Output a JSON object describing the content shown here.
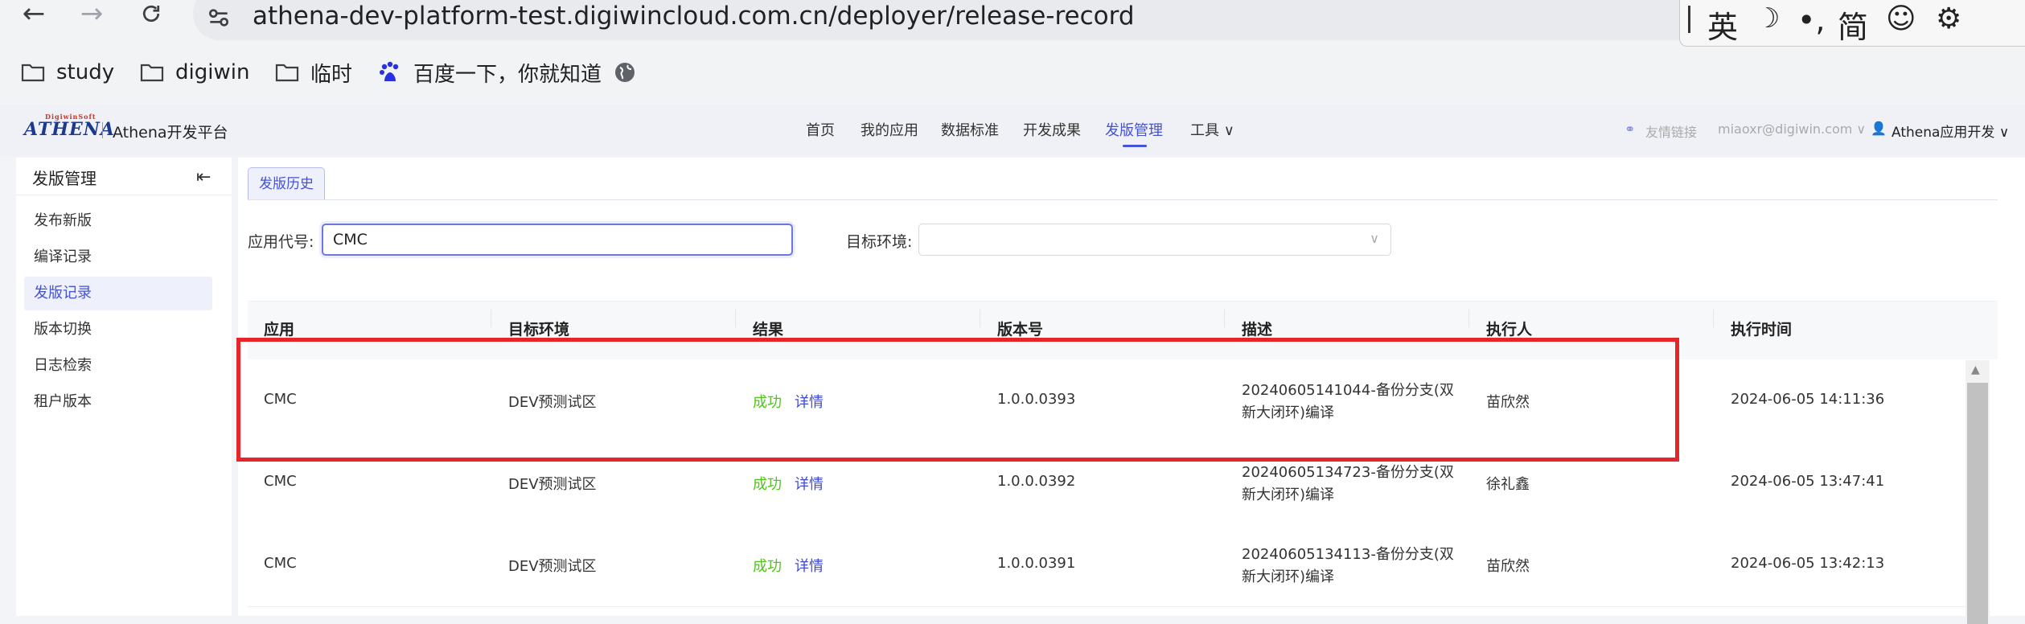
{
  "browser": {
    "url": "athena-dev-platform-test.digiwincloud.com.cn/deployer/release-record",
    "bookmarks": [
      "study",
      "digiwin",
      "临时",
      "百度一下，你就知道"
    ],
    "ime": [
      "英",
      "简"
    ]
  },
  "header": {
    "logo_text": "ATHENA",
    "logo_small": "DigiwinSoft",
    "platform": "Athena开发平台",
    "nav": [
      "首页",
      "我的应用",
      "数据标准",
      "开发成果",
      "发版管理",
      "工具 ∨"
    ],
    "active_nav": "发版管理",
    "links": [
      "友情链接",
      "miaoxr@digiwin.com ∨"
    ],
    "user": "Athena应用开发 ∨"
  },
  "sidebar": {
    "title": "发版管理",
    "items": [
      "发布新版",
      "编译记录",
      "发版记录",
      "版本切换",
      "日志检索",
      "租户版本"
    ],
    "active_item": "发版记录"
  },
  "main": {
    "tab": "发版历史",
    "filters": {
      "app_code_label": "应用代号:",
      "app_code_value": "CMC",
      "env_label": "目标环境:",
      "env_value": ""
    },
    "columns": [
      "应用",
      "目标环境",
      "结果",
      "版本号",
      "描述",
      "执行人",
      "执行时间"
    ],
    "rows": [
      {
        "app": "CMC",
        "env": "DEV预测试区",
        "result": "成功",
        "detail": "详情",
        "version": "1.0.0.0393",
        "desc1": "20240605141044-备份分支(双",
        "desc2": "新大闭环)编译",
        "executor": "苗欣然",
        "time": "2024-06-05 14:11:36"
      },
      {
        "app": "CMC",
        "env": "DEV预测试区",
        "result": "成功",
        "detail": "详情",
        "version": "1.0.0.0392",
        "desc1": "20240605134723-备份分支(双",
        "desc2": "新大闭环)编译",
        "executor": "徐礼鑫",
        "time": "2024-06-05 13:47:41"
      },
      {
        "app": "CMC",
        "env": "DEV预测试区",
        "result": "成功",
        "detail": "详情",
        "version": "1.0.0.0391",
        "desc1": "20240605134113-备份分支(双",
        "desc2": "新大闭环)编译",
        "executor": "苗欣然",
        "time": "2024-06-05 13:42:13"
      }
    ]
  },
  "colors": {
    "accent": "#4452d8",
    "success": "#52c41a",
    "annotation": "#e5252a"
  }
}
